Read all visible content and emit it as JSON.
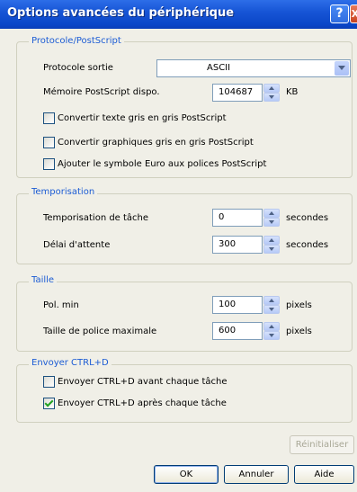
{
  "window": {
    "title": "Options avancées du périphérique",
    "help_glyph": "?",
    "close_glyph": "X"
  },
  "postscript": {
    "group_label": "Protocole/PostScript",
    "protocol_label": "Protocole sortie",
    "protocol_value": "ASCII",
    "memory_label": "Mémoire PostScript dispo.",
    "memory_value": "104687",
    "memory_unit": "KB",
    "checkboxes": [
      {
        "label": "Convertir texte gris en gris PostScript",
        "checked": false
      },
      {
        "label": "Convertir graphiques gris en gris PostScript",
        "checked": false
      },
      {
        "label": "Ajouter le symbole Euro aux polices PostScript",
        "checked": false
      }
    ]
  },
  "timeout": {
    "group_label": "Temporisation",
    "job_label": "Temporisation de tâche",
    "job_value": "0",
    "job_unit": "secondes",
    "wait_label": "Délai d'attente",
    "wait_value": "300",
    "wait_unit": "secondes"
  },
  "size": {
    "group_label": "Taille",
    "min_label": "Pol. min",
    "min_value": "100",
    "min_unit": "pixels",
    "max_label": "Taille de police maximale",
    "max_value": "600",
    "max_unit": "pixels"
  },
  "ctrld": {
    "group_label": "Envoyer CTRL+D",
    "checkboxes": [
      {
        "label": "Envoyer CTRL+D avant chaque tâche",
        "checked": false
      },
      {
        "label": "Envoyer CTRL+D après chaque tâche",
        "checked": true
      }
    ]
  },
  "buttons": {
    "reset": "Réinitialiser",
    "ok": "OK",
    "cancel": "Annuler",
    "help": "Aide"
  }
}
